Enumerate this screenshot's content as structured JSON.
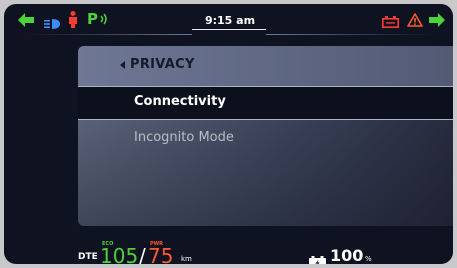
{
  "status_bar": {
    "time": "9:15 am",
    "icons": [
      "left-turn-signal-icon",
      "headlight-icon",
      "seatbelt-icon",
      "parking-assist-icon",
      "battery-warning-icon",
      "warning-triangle-icon",
      "right-turn-signal-icon"
    ]
  },
  "menu": {
    "title": "PRIVACY",
    "items": [
      {
        "label": "Connectivity",
        "selected": true
      },
      {
        "label": "Incognito Mode",
        "selected": false
      }
    ]
  },
  "bottom_bar": {
    "dte_label": "DTE",
    "eco_label": "ECO",
    "eco_value": "105",
    "separator": "/",
    "pwr_label": "PWR",
    "pwr_value": "75",
    "distance_unit": "km",
    "battery_value": "100",
    "battery_unit": "%"
  },
  "colors": {
    "green": "#4cd23a",
    "red": "#ff3b2f",
    "orange": "#ff5a2a",
    "blue": "#3a8dff",
    "background": "#0f1220"
  }
}
